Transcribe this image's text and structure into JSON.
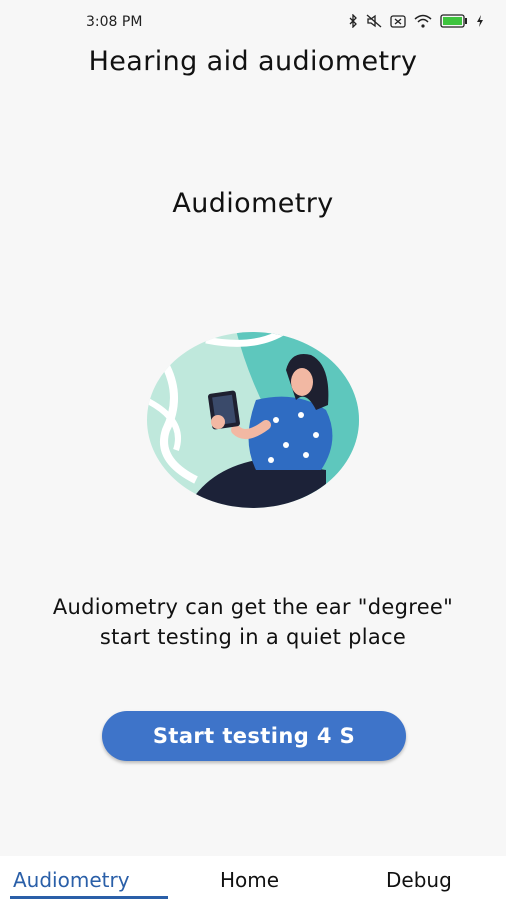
{
  "status_bar": {
    "time": "3:08 PM",
    "icons": [
      "bluetooth-icon",
      "mute-icon",
      "close-box-icon",
      "wifi-icon",
      "battery-icon",
      "charging-bolt-icon"
    ]
  },
  "app_title": "Hearing aid audiometry",
  "section_title": "Audiometry",
  "illustration": {
    "name": "woman-with-tablet-illustration",
    "colors": {
      "circle": "#5ec7bd",
      "circle_light": "#bfe8dc",
      "shirt": "#2f6cc2",
      "hair": "#1e2030",
      "pants": "#1c2238",
      "skin": "#f2b8a3"
    }
  },
  "description": {
    "line1": "Audiometry can get the ear \"degree\"",
    "line2": "start testing in a quiet place"
  },
  "start_button": {
    "label": "Start testing 4 S",
    "color": "#3e74c9"
  },
  "bottom_nav": {
    "tabs": [
      {
        "label": "Audiometry",
        "active": true
      },
      {
        "label": "Home",
        "active": false
      },
      {
        "label": "Debug",
        "active": false
      }
    ],
    "accent": "#2a5fa8"
  }
}
